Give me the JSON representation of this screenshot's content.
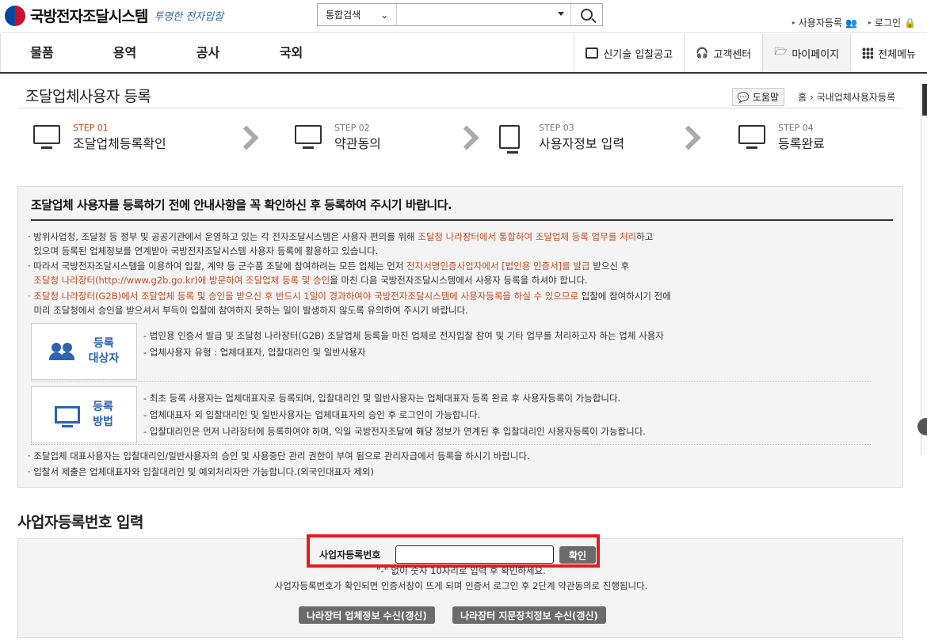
{
  "header": {
    "logo_text": "국방전자조달시스템",
    "slogan": "투명한 전자입찰",
    "search_scope": "통합검색",
    "search_placeholder": "",
    "util_register": "사용자등록",
    "util_login": "로그인"
  },
  "nav": {
    "menu": [
      "물품",
      "용역",
      "공사",
      "국외"
    ],
    "right": [
      "신기술 입찰공고",
      "고객센터",
      "마이페이지",
      "전체메뉴"
    ]
  },
  "page": {
    "title": "조달업체사용자 등록",
    "help": "도움말",
    "breadcrumb": "홈 › 국내업체사용자등록"
  },
  "steps": [
    {
      "num": "STEP 01",
      "label": "조달업체등록확인"
    },
    {
      "num": "STEP 02",
      "label": "약관동의"
    },
    {
      "num": "STEP 03",
      "label": "사용자정보 입력"
    },
    {
      "num": "STEP 04",
      "label": "등록완료"
    }
  ],
  "notice": {
    "heading": "조달업체 사용자를 등록하기 전에 안내사항을 꼭 확인하신 후 등록하여 주시기 바랍니다.",
    "b1_a": "· 방위사업청, 조달청 등 정부 및 공공기관에서 운영하고 있는 각 전자조달시스템은 사용자 편의를 위해 ",
    "b1_o": "조달청 나라장터에서 통합하여 조달업체 등록 업무를 처리",
    "b1_b": "하고",
    "b1_c": "있으며 등록된 업체정보를 연계받아 국방전자조달시스템 사용자 등록에 활용하고 있습니다.",
    "b2_a": "· 따라서 국방전자조달시스템을 이용하여 입찰, 계약 등 군수품 조달에 참여하려는 모든 업체는 먼저 ",
    "b2_o": "전자서명인증사업자에서 [법인용 인증서]를 발급",
    "b2_b": " 받으신 후",
    "b2_o2": "조달청 나라장터(http://www.g2b.go.kr)에 방문하여 조달업체 등록 및 승인",
    "b2_c": "을 마친 다음 국방전자조달시스템에서 사용자 등록을 하셔야 합니다.",
    "b3_o": "· 조달청 나라장터(G2B)에서 조달업체 등록 및 승인을 받으신 후 반드시 1일이 경과하여야 국방전자조달시스템에 사용자등록을 하실 수 있으므로",
    "b3_a": " 입찰에 참여하시기 전에",
    "b3_b": "미리 조달청에서 승인을 받으셔서 부득이 입찰에 참여하지 못하는 일이 발생하지 않도록 유의하여 주시기 바랍니다.",
    "target_label_1": "등록",
    "target_label_2": "대상자",
    "target_desc": [
      "- 법인용 인증서 발급 및 조달청 나라장터(G2B) 조달업체 등록을 마친 업체로 전자입찰 참여 및 기타 업무를 처리하고자 하는 업체 사용자",
      "- 업체사용자 유형 : 업체대표자, 입찰대리인 및 일반사용자"
    ],
    "method_label_1": "등록",
    "method_label_2": "방법",
    "method_desc": [
      "- 최초 등록 사용자는 업체대표자로 등록되며, 입찰대리인 및 일반사용자는 업체대표자 등록 완료 후 사용자등록이 가능합니다.",
      "- 업체대표자 외 입찰대리인 및 일반사용자는 업체대표자의 승인 후 로그인이 가능합니다.",
      "- 입찰대리인은 먼저 나라장터에 등록하여야 하며, 익일 국방전자조달에 해당 정보가 연계된 후 입찰대리인 사용자등록이 가능합니다."
    ],
    "b4": "· 조달업체 대표사용자는 입찰대리인/일반사용자의 승인 및 사용중단 관리 권한이 부여 됨으로 관리자급에서 등록을 하시기 바랍니다.",
    "b5": "· 입찰서 제출은 업체대표자와 입찰대리인 및 예외처리자만 가능합니다.(외국인대표자 제외)"
  },
  "biz": {
    "heading": "사업자등록번호 입력",
    "label": "사업자등록번호",
    "value": "",
    "confirm": "확인",
    "hint1": "\"-\" 없이 숫자 10자리로 입력 후 확인하세요.",
    "hint2": "사업자등록번호가 확인되면 인증서창이 뜨게 되며 인증서 로그인 후 2단계 약관동의로 진행됩니다.",
    "btn1": "나라장터 업체정보 수신(갱신)",
    "btn2": "나라장터 지문장치정보 수신(갱신)"
  }
}
